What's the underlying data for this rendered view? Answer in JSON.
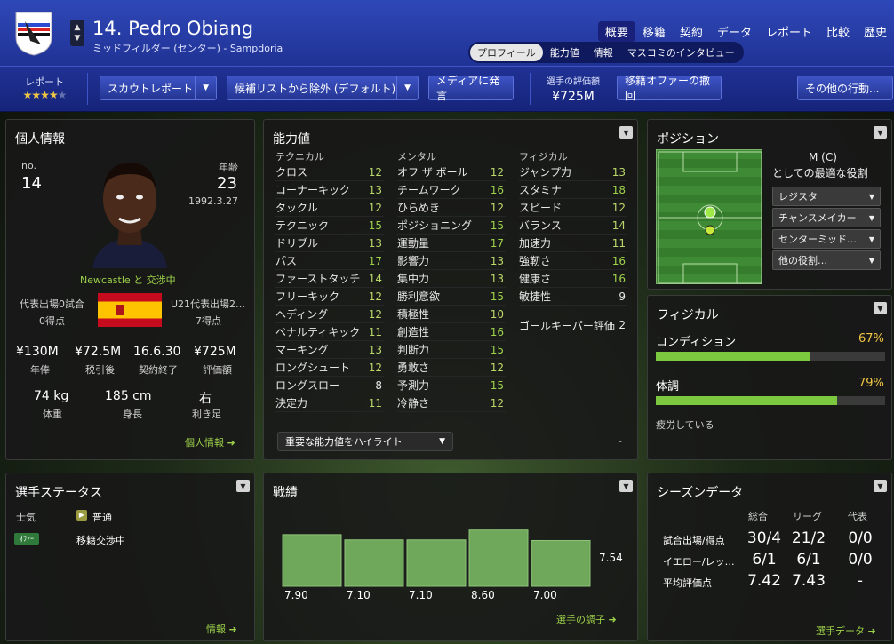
{
  "header": {
    "player_name": "14. Pedro Obiang",
    "subtitle": "ミッドフィルダー (センター) - Sampdoria",
    "top_nav": [
      "概要",
      "移籍",
      "契約",
      "データ",
      "レポート",
      "比較",
      "歴史"
    ],
    "sub_tabs": [
      "プロフィール",
      "能力値",
      "情報",
      "マスコミのインタビュー"
    ],
    "reputation_label": "レポート",
    "reputation_stars": "★★★★",
    "reputation_stars_off": "★",
    "buttons": {
      "scout_report": "スカウトレポート",
      "remove_shortlist": "候補リストから除外 (デフォルト)",
      "media": "メディアに発言",
      "withdraw_offer": "移籍オファーの撤回",
      "other_actions": "その他の行動..."
    },
    "value_label": "選手の評価額",
    "value": "¥725M"
  },
  "personal": {
    "title": "個人情報",
    "no_label": "no.",
    "no": "14",
    "age_label": "年齢",
    "age": "23",
    "dob": "1992.3.27",
    "transfer_note_club": "Newcastle",
    "transfer_note_rest": " と 交渉中",
    "caps_left": "代表出場0試合",
    "goals_left": "0得点",
    "caps_right": "U21代表出場2…",
    "goals_right": "7得点",
    "money": [
      {
        "v": "¥130M",
        "l": "年俸"
      },
      {
        "v": "¥72.5M",
        "l": "税引後"
      },
      {
        "v": "16.6.30",
        "l": "契約終了"
      },
      {
        "v": "¥725M",
        "l": "評価額"
      }
    ],
    "body": [
      {
        "v": "74 kg",
        "l": "体重"
      },
      {
        "v": "185 cm",
        "l": "身長"
      },
      {
        "v": "右",
        "l": "利き足"
      }
    ],
    "link": "個人情報"
  },
  "attributes": {
    "title": "能力値",
    "technical_title": "テクニカル",
    "mental_title": "メンタル",
    "physical_title": "フィジカル",
    "technical": [
      {
        "n": "クロス",
        "v": "12"
      },
      {
        "n": "コーナーキック",
        "v": "13"
      },
      {
        "n": "タックル",
        "v": "12"
      },
      {
        "n": "テクニック",
        "v": "15"
      },
      {
        "n": "ドリブル",
        "v": "13"
      },
      {
        "n": "パス",
        "v": "17"
      },
      {
        "n": "ファーストタッチ",
        "v": "14"
      },
      {
        "n": "フリーキック",
        "v": "12"
      },
      {
        "n": "ヘディング",
        "v": "12"
      },
      {
        "n": "ペナルティキック",
        "v": "11"
      },
      {
        "n": "マーキング",
        "v": "13"
      },
      {
        "n": "ロングシュート",
        "v": "12"
      },
      {
        "n": "ロングスロー",
        "v": "8"
      },
      {
        "n": "決定力",
        "v": "11"
      }
    ],
    "mental": [
      {
        "n": "オフ ザ ボール",
        "v": "12"
      },
      {
        "n": "チームワーク",
        "v": "16"
      },
      {
        "n": "ひらめき",
        "v": "12"
      },
      {
        "n": "ポジショニング",
        "v": "15"
      },
      {
        "n": "運動量",
        "v": "17"
      },
      {
        "n": "影響力",
        "v": "13"
      },
      {
        "n": "集中力",
        "v": "13"
      },
      {
        "n": "勝利意欲",
        "v": "15"
      },
      {
        "n": "積極性",
        "v": "10"
      },
      {
        "n": "創造性",
        "v": "16"
      },
      {
        "n": "判断力",
        "v": "15"
      },
      {
        "n": "勇敢さ",
        "v": "12"
      },
      {
        "n": "予測力",
        "v": "15"
      },
      {
        "n": "冷静さ",
        "v": "12"
      }
    ],
    "physical": [
      {
        "n": "ジャンプ力",
        "v": "13"
      },
      {
        "n": "スタミナ",
        "v": "18"
      },
      {
        "n": "スピード",
        "v": "12"
      },
      {
        "n": "バランス",
        "v": "14"
      },
      {
        "n": "加速力",
        "v": "11"
      },
      {
        "n": "強靭さ",
        "v": "16"
      },
      {
        "n": "健康さ",
        "v": "16"
      },
      {
        "n": "敏捷性",
        "v": "9"
      }
    ],
    "gk_label": "ゴールキーパー評価",
    "gk_value": "2",
    "highlight_select": "重要な能力値をハイライト",
    "dash": "-"
  },
  "position": {
    "title": "ポジション",
    "role_heading_1": "M (C)",
    "role_heading_2": "としての最適な役割",
    "roles": [
      "レジスタ",
      "チャンスメイカー",
      "センターミッド…",
      "他の役割…"
    ]
  },
  "physical_panel": {
    "title": "フィジカル",
    "condition_label": "コンディション",
    "condition_value": "67%",
    "condition_fraction": 0.67,
    "fitness_label": "体調",
    "fitness_value": "79%",
    "fitness_fraction": 0.79,
    "status": "疲労している"
  },
  "status_panel": {
    "title": "選手ステータス",
    "morale_label": "士気",
    "morale_value": "普通",
    "offer_badge": "ｵﾌｧｰ",
    "offer_text": "移籍交渉中",
    "link": "情報"
  },
  "form_panel": {
    "title": "戦績",
    "link": "選手の調子",
    "average": "7.54"
  },
  "chart_data": {
    "type": "bar",
    "categories": [
      "1",
      "2",
      "3",
      "4",
      "5"
    ],
    "values": [
      7.9,
      7.1,
      7.1,
      8.6,
      7.0
    ],
    "labels": [
      "7.90",
      "7.10",
      "7.10",
      "8.60",
      "7.00"
    ],
    "ylim": [
      0,
      10
    ]
  },
  "season_panel": {
    "title": "シーズンデータ",
    "cols": [
      "総合",
      "リーグ",
      "代表"
    ],
    "rows": [
      {
        "l": "試合出場/得点",
        "v": [
          "30/4",
          "21/2",
          "0/0"
        ]
      },
      {
        "l": "イエロー/レッ…",
        "v": [
          "6/1",
          "6/1",
          "0/0"
        ]
      },
      {
        "l": "平均評価点",
        "v": [
          "7.42",
          "7.43",
          "-"
        ]
      }
    ],
    "link": "選手データ"
  },
  "colors": {
    "header_blue": "#2f48b8",
    "accent_green": "#9ed24a",
    "condition_orange": "#f2c744"
  }
}
